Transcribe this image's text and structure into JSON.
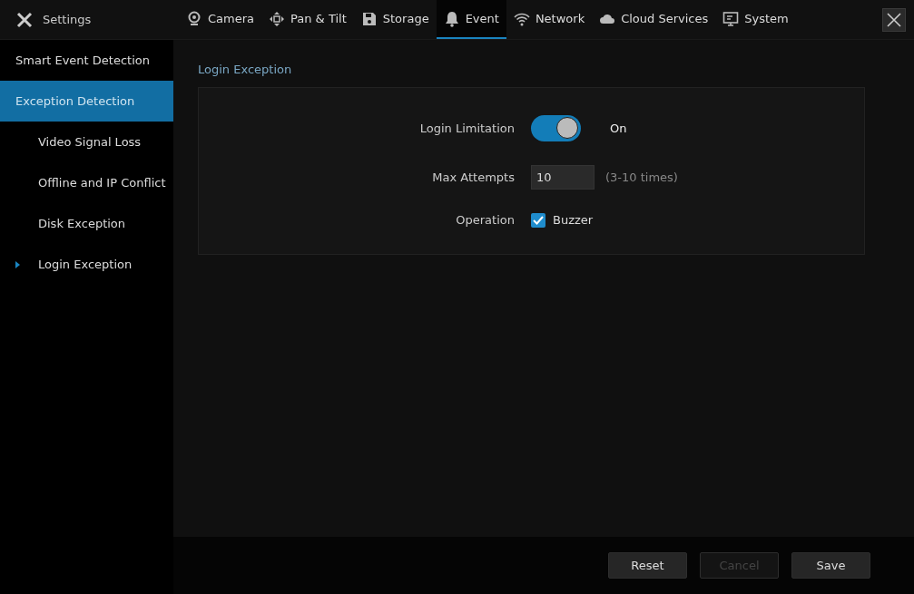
{
  "app": {
    "title": "Settings"
  },
  "tabs": [
    {
      "label": "Camera",
      "kind": "camera",
      "selected": false
    },
    {
      "label": "Pan & Tilt",
      "kind": "pantilt",
      "selected": false
    },
    {
      "label": "Storage",
      "kind": "storage",
      "selected": false
    },
    {
      "label": "Event",
      "kind": "event",
      "selected": true
    },
    {
      "label": "Network",
      "kind": "network",
      "selected": false
    },
    {
      "label": "Cloud Services",
      "kind": "cloud",
      "selected": false
    },
    {
      "label": "System",
      "kind": "system",
      "selected": false
    }
  ],
  "sidebar": {
    "items": [
      {
        "label": "Smart Event Detection",
        "selected": false
      },
      {
        "label": "Exception Detection",
        "selected": true,
        "children": [
          {
            "label": "Video Signal Loss",
            "current": false
          },
          {
            "label": "Offline and IP Conflict",
            "current": false
          },
          {
            "label": "Disk Exception",
            "current": false
          },
          {
            "label": "Login Exception",
            "current": true
          }
        ]
      }
    ]
  },
  "section_title": "Login Exception",
  "form": {
    "login_limitation": {
      "label": "Login Limitation",
      "on": true,
      "state_text": "On"
    },
    "max_attempts": {
      "label": "Max Attempts",
      "value": "10",
      "hint": "(3-10 times)"
    },
    "operation": {
      "label": "Operation",
      "option": "Buzzer",
      "checked": true
    }
  },
  "buttons": [
    {
      "label": "Reset",
      "disabled": false
    },
    {
      "label": "Cancel",
      "disabled": true
    },
    {
      "label": "Save",
      "disabled": false
    }
  ]
}
